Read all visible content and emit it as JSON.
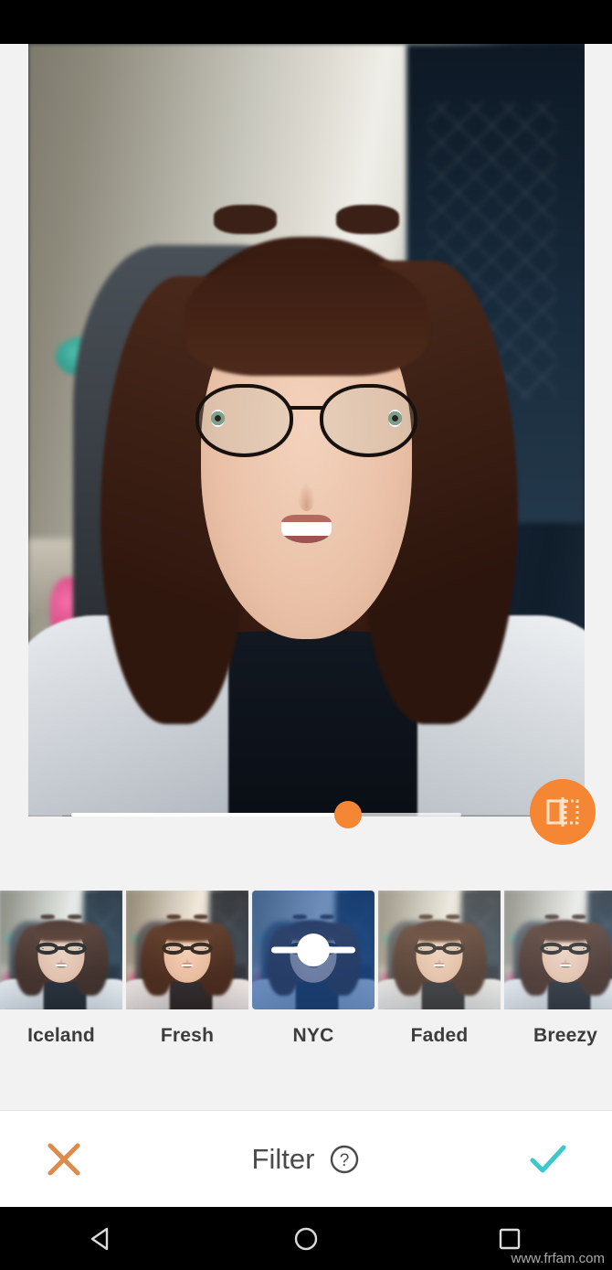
{
  "app": {
    "screen_title": "Filter",
    "background_color": "#f2f2f2",
    "accent_color": "#f58634",
    "confirm_color": "#3bc9d0"
  },
  "editor": {
    "photo_alt": "portrait-photo-of-smiling-woman-with-glasses",
    "intensity_slider": {
      "name": "filter-intensity-slider",
      "value_percent": 71,
      "min": 0,
      "max": 100,
      "track_color": "#ffffff",
      "thumb_color": "#f58634"
    },
    "compare_button": {
      "icon": "compare-before-after-icon",
      "background_color": "#f58634"
    }
  },
  "filters": {
    "selected_index": 2,
    "items": [
      {
        "label": "Iceland",
        "tone_class": "tone-iceland",
        "selected": false
      },
      {
        "label": "Fresh",
        "tone_class": "tone-fresh",
        "selected": false
      },
      {
        "label": "NYC",
        "tone_class": "tone-nyc",
        "selected": true
      },
      {
        "label": "Faded",
        "tone_class": "tone-faded",
        "selected": false
      },
      {
        "label": "Breezy",
        "tone_class": "tone-breezy",
        "selected": false
      }
    ],
    "selected_thumb_slider": {
      "name": "nyc-strength-slider",
      "value_percent": 50
    }
  },
  "action_bar": {
    "cancel": {
      "label": "cancel-x-icon",
      "color": "#e08a4a"
    },
    "title": "Filter",
    "help": {
      "label": "help-question-icon",
      "color": "#4a4a4a"
    },
    "confirm": {
      "label": "confirm-check-icon",
      "color": "#3bc9d0"
    }
  },
  "nav_bar": {
    "back": "back-triangle-icon",
    "home": "home-circle-icon",
    "recents": "recents-square-icon"
  },
  "watermark": {
    "text": "www.frfam.com"
  }
}
